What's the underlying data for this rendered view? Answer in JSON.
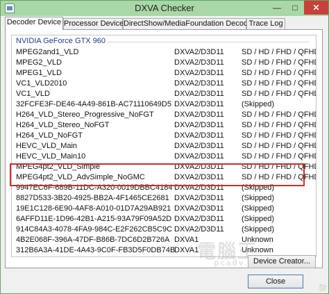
{
  "window": {
    "title": "DXVA Checker",
    "minimize_glyph": "—",
    "maximize_glyph": "□",
    "close_glyph": "✕"
  },
  "tabs": [
    {
      "label": "Decoder Device",
      "active": true
    },
    {
      "label": "Processor Device",
      "active": false
    },
    {
      "label": "DirectShow/MediaFoundation Decoder",
      "active": false
    },
    {
      "label": "Trace Log",
      "active": false
    }
  ],
  "decoder_list": {
    "group": "NVIDIA GeForce GTX 960",
    "rows": [
      {
        "name": "MPEG2and1_VLD",
        "api": "DXVA2/D3D11",
        "resolution": "SD / HD / FHD / QFHD"
      },
      {
        "name": "MPEG2_VLD",
        "api": "DXVA2/D3D11",
        "resolution": "SD / HD / FHD / QFHD"
      },
      {
        "name": "MPEG1_VLD",
        "api": "DXVA2/D3D11",
        "resolution": "SD / HD / FHD / QFHD"
      },
      {
        "name": "VC1_VLD2010",
        "api": "DXVA2/D3D11",
        "resolution": "SD / HD / FHD / QFHD"
      },
      {
        "name": "VC1_VLD",
        "api": "DXVA2/D3D11",
        "resolution": "SD / HD / FHD / QFHD"
      },
      {
        "name": "32FCFE3F-DE46-4A49-861B-AC71110649D5",
        "api": "DXVA2/D3D11",
        "resolution": "(Skipped)"
      },
      {
        "name": "H264_VLD_Stereo_Progressive_NoFGT",
        "api": "DXVA2/D3D11",
        "resolution": "SD / HD / FHD / QFHD"
      },
      {
        "name": "H264_VLD_Stereo_NoFGT",
        "api": "DXVA2/D3D11",
        "resolution": "SD / HD / FHD / QFHD"
      },
      {
        "name": "H264_VLD_NoFGT",
        "api": "DXVA2/D3D11",
        "resolution": "SD / HD / FHD / QFHD"
      },
      {
        "name": "HEVC_VLD_Main",
        "api": "DXVA2/D3D11",
        "resolution": "SD / HD / FHD / QFHD"
      },
      {
        "name": "HEVC_VLD_Main10",
        "api": "DXVA2/D3D11",
        "resolution": "SD / HD / FHD / QFHD"
      },
      {
        "name": "MPEG4pt2_VLD_Simple",
        "api": "DXVA2/D3D11",
        "resolution": "SD / HD / FHD / QFHD"
      },
      {
        "name": "MPEG4pt2_VLD_AdvSimple_NoGMC",
        "api": "DXVA2/D3D11",
        "resolution": "SD / HD / FHD / QFHD"
      },
      {
        "name": "9947EC6F-689B-11DC-A320-0019DBBC4184",
        "api": "DXVA2/D3D11",
        "resolution": "(Skipped)"
      },
      {
        "name": "8827D533-3B20-4925-BB2A-4F1465CE2681",
        "api": "DXVA2/D3D11",
        "resolution": "(Skipped)"
      },
      {
        "name": "19E1C128-6E90-4AF8-A010-01D7A29AB921",
        "api": "DXVA2/D3D11",
        "resolution": "(Skipped)"
      },
      {
        "name": "6AFFD11E-1D96-42B1-A215-93A79F09A52D",
        "api": "DXVA2/D3D11",
        "resolution": "(Skipped)"
      },
      {
        "name": "914C84A3-4078-4FA9-984C-E2F262CB5C9C",
        "api": "DXVA2/D3D11",
        "resolution": "(Skipped)"
      },
      {
        "name": "4B2E068F-396A-47DF-B86B-7DC6D2B726A",
        "api": "DXVA1",
        "resolution": "Unknown"
      },
      {
        "name": "312B6A3A-41DE-4A43-9C0F-FB3D5F0DB74B",
        "api": "DXVA1",
        "resolution": "Unknown"
      }
    ]
  },
  "watermark": {
    "text": "電腦王",
    "sub": "pcadv.tw"
  },
  "buttons": {
    "device_creator": "Device Creator...",
    "close": "Close"
  }
}
